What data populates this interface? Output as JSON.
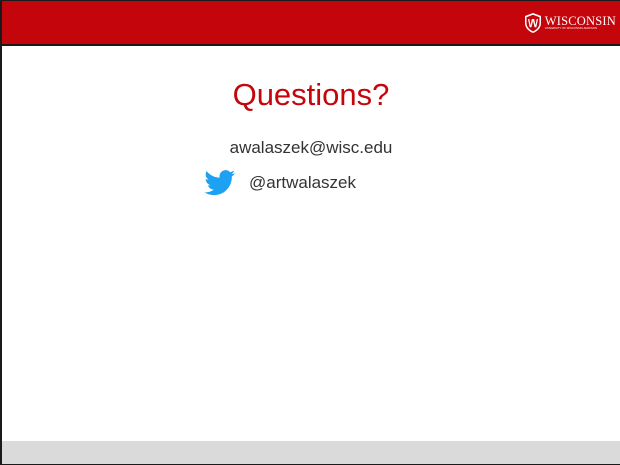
{
  "header": {
    "logo_word": "WISCONSIN",
    "logo_subtext": "UNIVERSITY OF WISCONSIN–MADISON",
    "logo_icon": "uw-crest-icon",
    "accent_color": "#c5050c"
  },
  "main": {
    "title": "Questions?",
    "email": "awalaszek@wisc.edu",
    "twitter_icon": "twitter-bird-icon",
    "twitter_color": "#1da1f2",
    "twitter_handle": "@artwalaszek"
  },
  "footer": {
    "bar_color": "#dadada"
  }
}
